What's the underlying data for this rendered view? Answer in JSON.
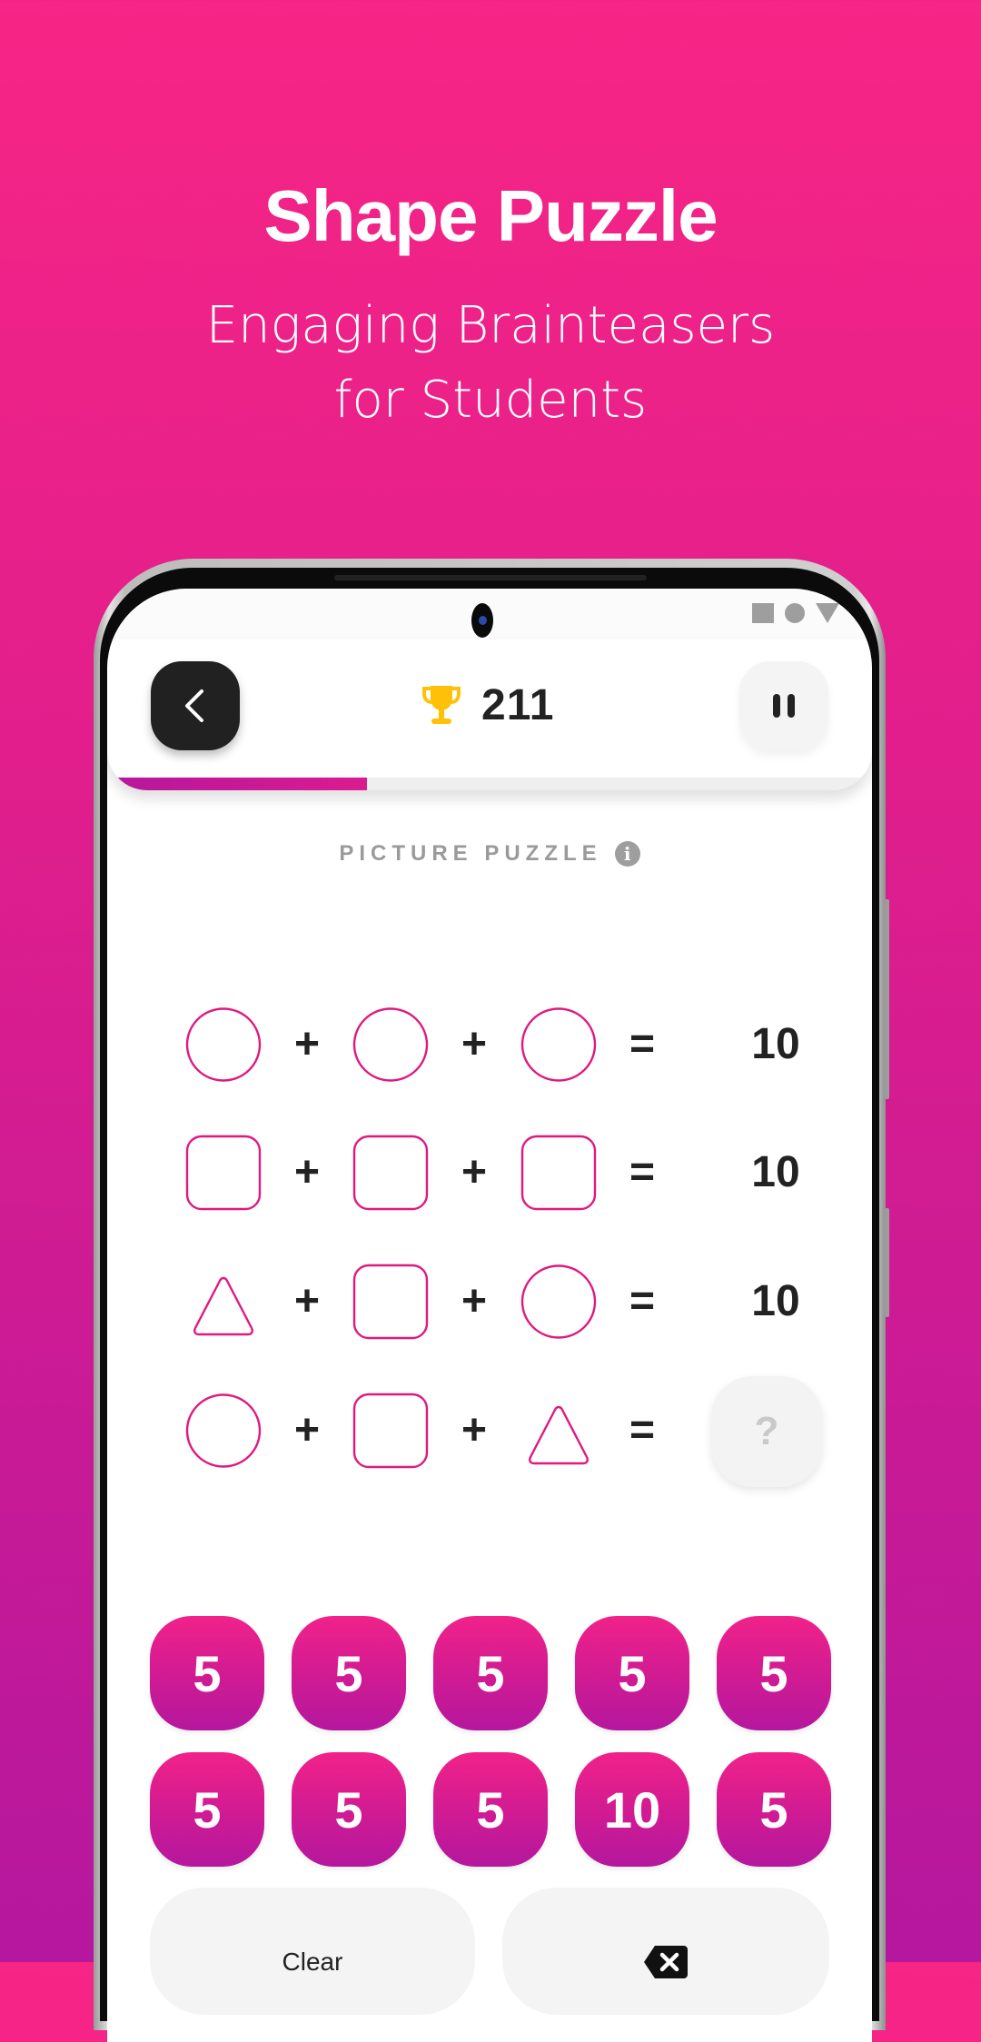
{
  "hero": {
    "title": "Shape Puzzle",
    "subtitle_lines": [
      "Engaging Brainteasers",
      "for Students"
    ]
  },
  "status_bar": {
    "icons": [
      "square-icon",
      "circle-icon",
      "triangle-icon"
    ]
  },
  "header": {
    "back_icon": "chevron-left-icon",
    "score_icon": "trophy-icon",
    "score": "211",
    "pause_icon": "pause-icon",
    "progress_percent": 34
  },
  "puzzle": {
    "label": "PICTURE PUZZLE",
    "info_icon": "i",
    "equations": [
      {
        "shapes": [
          "circle",
          "circle",
          "circle"
        ],
        "operators": [
          "+",
          "+",
          "="
        ],
        "result": "10"
      },
      {
        "shapes": [
          "square",
          "square",
          "square"
        ],
        "operators": [
          "+",
          "+",
          "="
        ],
        "result": "10"
      },
      {
        "shapes": [
          "triangle",
          "square",
          "circle"
        ],
        "operators": [
          "+",
          "+",
          "="
        ],
        "result": "10"
      },
      {
        "shapes": [
          "circle",
          "square",
          "triangle"
        ],
        "operators": [
          "+",
          "+",
          "="
        ],
        "result": "?"
      }
    ]
  },
  "keypad": {
    "rows": [
      [
        "5",
        "5",
        "5",
        "5",
        "5"
      ],
      [
        "5",
        "5",
        "5",
        "10",
        "5"
      ]
    ],
    "clear_label": "Clear",
    "backspace_icon": "backspace-icon"
  },
  "colors": {
    "background_top": "#F72585",
    "background_bottom": "#B5179E",
    "accent": "#E0197F",
    "shape_stroke": "#E0197F",
    "trophy": "#FFC107",
    "text_dark": "#222222"
  }
}
